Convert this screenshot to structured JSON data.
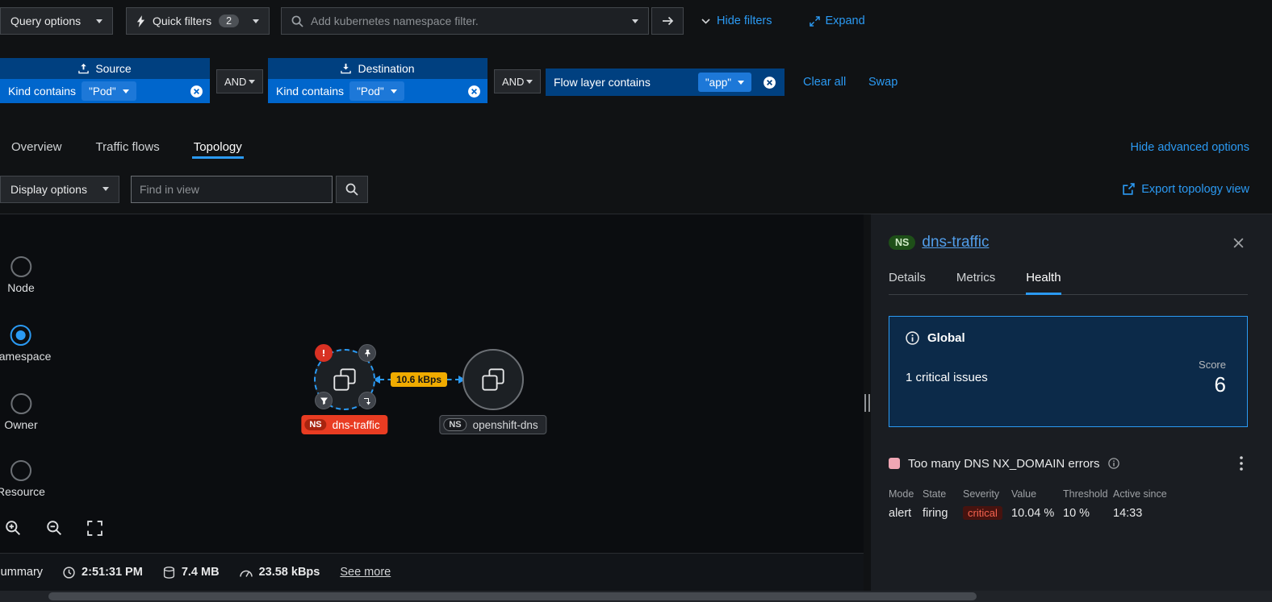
{
  "colors": {
    "accent_blue": "#2b9af3",
    "filter_group_bg": "#004080",
    "filter_row_bg": "#0066cc",
    "edge_label_bg": "#f0ab00",
    "node_alert_label_bg": "#e93c22",
    "alert_decoration_red": "#d93123",
    "critical_text": "#f4624e",
    "score_card_bg": "#0c2a49",
    "namespace_badge_green": "#1e4f18"
  },
  "topbar": {
    "query_options_label": "Query options",
    "quick_filters_label": "Quick filters",
    "quick_filters_count": "2",
    "filter_search_placeholder": "Add kubernetes namespace filter.",
    "hide_filters_label": "Hide filters",
    "expand_label": "Expand"
  },
  "filter_bar": {
    "source": {
      "title": "Source",
      "field_label": "Kind contains",
      "value": "\"Pod\""
    },
    "and_1": "AND",
    "destination": {
      "title": "Destination",
      "field_label": "Kind contains",
      "value": "\"Pod\""
    },
    "and_2": "AND",
    "flow_layer": {
      "field_label": "Flow layer contains",
      "value": "\"app\""
    },
    "clear_all_label": "Clear all",
    "swap_label": "Swap"
  },
  "view_tabs": {
    "overview": "Overview",
    "traffic_flows": "Traffic flows",
    "topology": "Topology",
    "hide_advanced_label": "Hide advanced options"
  },
  "topology_toolbar": {
    "display_options_label": "Display options",
    "find_placeholder": "Find in view",
    "export_label": "Export topology view"
  },
  "canvas": {
    "scope_options": [
      {
        "label": "Node",
        "selected": false
      },
      {
        "label": "Namespace",
        "selected": true
      },
      {
        "label": "Owner",
        "selected": false
      },
      {
        "label": "Resource",
        "selected": false
      }
    ],
    "edge": {
      "label": "10.6 kBps"
    },
    "source_node": {
      "badge": "NS",
      "label": "dns-traffic"
    },
    "target_node": {
      "badge": "NS",
      "label": "openshift-dns"
    },
    "status_bar": {
      "summary_label": "Summary",
      "time": "2:51:31 PM",
      "bytes": "7.4 MB",
      "rate": "23.58 kBps",
      "see_more_label": "See more"
    }
  },
  "side_panel": {
    "resource_badge": "NS",
    "title": "dns-traffic",
    "tabs": {
      "details": "Details",
      "metrics": "Metrics",
      "health": "Health"
    },
    "active_tab": "Health",
    "score_card": {
      "title": "Global",
      "issues_text": "1 critical issues",
      "score_label": "Score",
      "score_value": "6"
    },
    "alert": {
      "title": "Too many DNS NX_DOMAIN errors",
      "table": {
        "headers": [
          "Mode",
          "State",
          "Severity",
          "Value",
          "Threshold",
          "Active since"
        ],
        "row": {
          "mode": "alert",
          "state": "firing",
          "severity": "critical",
          "value": "10.04 %",
          "threshold": "10 %",
          "active_since": "14:33"
        }
      }
    }
  }
}
